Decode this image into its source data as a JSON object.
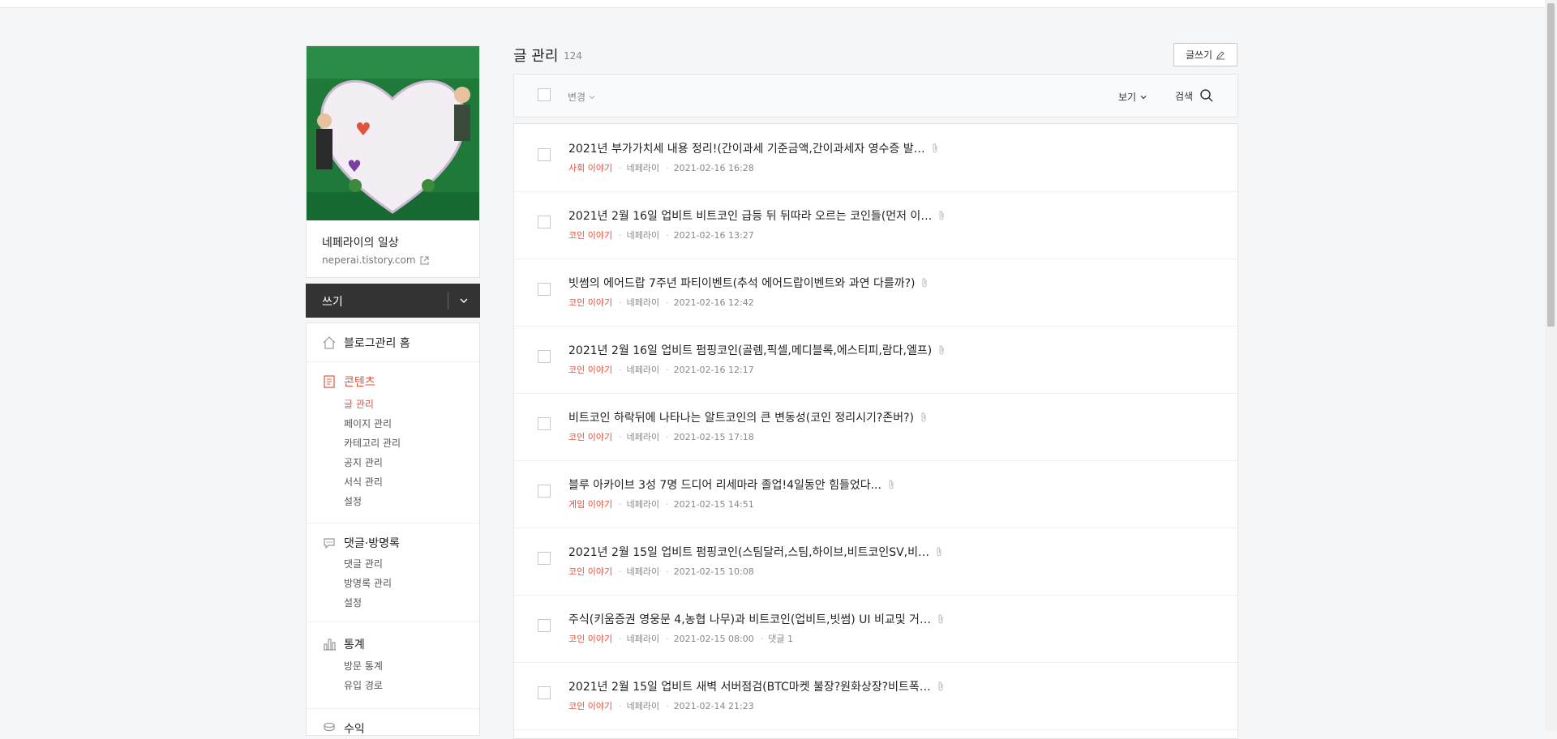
{
  "blog": {
    "title": "네페라이의 일상",
    "url": "neperai.tistory.com"
  },
  "write_bar": {
    "label": "쓰기"
  },
  "menu": {
    "home": "블로그관리 홈",
    "content": {
      "title": "콘텐츠",
      "items": [
        "글 관리",
        "페이지 관리",
        "카테고리 관리",
        "공지 관리",
        "서식 관리",
        "설정"
      ]
    },
    "comments": {
      "title": "댓글·방명록",
      "items": [
        "댓글 관리",
        "방명록 관리",
        "설정"
      ]
    },
    "stats": {
      "title": "통계",
      "items": [
        "방문 통계",
        "유입 경로"
      ]
    },
    "revenue": {
      "title": "수익"
    }
  },
  "header": {
    "title": "글 관리",
    "count": "124",
    "write_button": "글쓰기"
  },
  "toolbar": {
    "change_label": "변경",
    "view_label": "보기",
    "search_label": "검색"
  },
  "posts": [
    {
      "title": "2021년 부가가치세 내용 정리!(간이과세 기준금액,간이과세자 영수증 발…",
      "category": "사회 이야기",
      "author": "네페라이",
      "date": "2021-02-16 16:28",
      "comments": ""
    },
    {
      "title": "2021년 2월 16일 업비트 비트코인 급등 뒤 뒤따라 오르는 코인들(먼저 이…",
      "category": "코인 이야기",
      "author": "네페라이",
      "date": "2021-02-16 13:27",
      "comments": ""
    },
    {
      "title": "빗썸의 에어드랍 7주년 파티이벤트(추석 에어드랍이벤트와 과연 다를까?)",
      "category": "코인 이야기",
      "author": "네페라이",
      "date": "2021-02-16 12:42",
      "comments": ""
    },
    {
      "title": "2021년 2월 16일 업비트 펌핑코인(골렘,픽셀,메디블록,에스티피,람다,엘프)",
      "category": "코인 이야기",
      "author": "네페라이",
      "date": "2021-02-16 12:17",
      "comments": ""
    },
    {
      "title": "비트코인 하락뒤에 나타나는 알트코인의 큰 변동성(코인 정리시기?존버?)",
      "category": "코인 이야기",
      "author": "네페라이",
      "date": "2021-02-15 17:18",
      "comments": ""
    },
    {
      "title": "블루 아카이브 3성 7명 드디어 리세마라 졸업!4일동안 힘들었다...",
      "category": "게임 이야기",
      "author": "네페라이",
      "date": "2021-02-15 14:51",
      "comments": ""
    },
    {
      "title": "2021년 2월 15일 업비트 펌핑코인(스팀달러,스팀,하이브,비트코인SV,비…",
      "category": "코인 이야기",
      "author": "네페라이",
      "date": "2021-02-15 10:08",
      "comments": ""
    },
    {
      "title": "주식(키움증권 영웅문 4,농협 나무)과 비트코인(업비트,빗썸) UI 비교및 거…",
      "category": "코인 이야기",
      "author": "네페라이",
      "date": "2021-02-15 08:00",
      "comments": "댓글 1"
    },
    {
      "title": "2021년 2월 15일 업비트 새벽 서버점검(BTC마켓 불장?원화상장?비트폭…",
      "category": "코인 이야기",
      "author": "네페라이",
      "date": "2021-02-14 21:23",
      "comments": ""
    }
  ],
  "colors": {
    "accent": "#e0533f",
    "dark_bar": "#333333",
    "background": "#f5f6f7"
  }
}
